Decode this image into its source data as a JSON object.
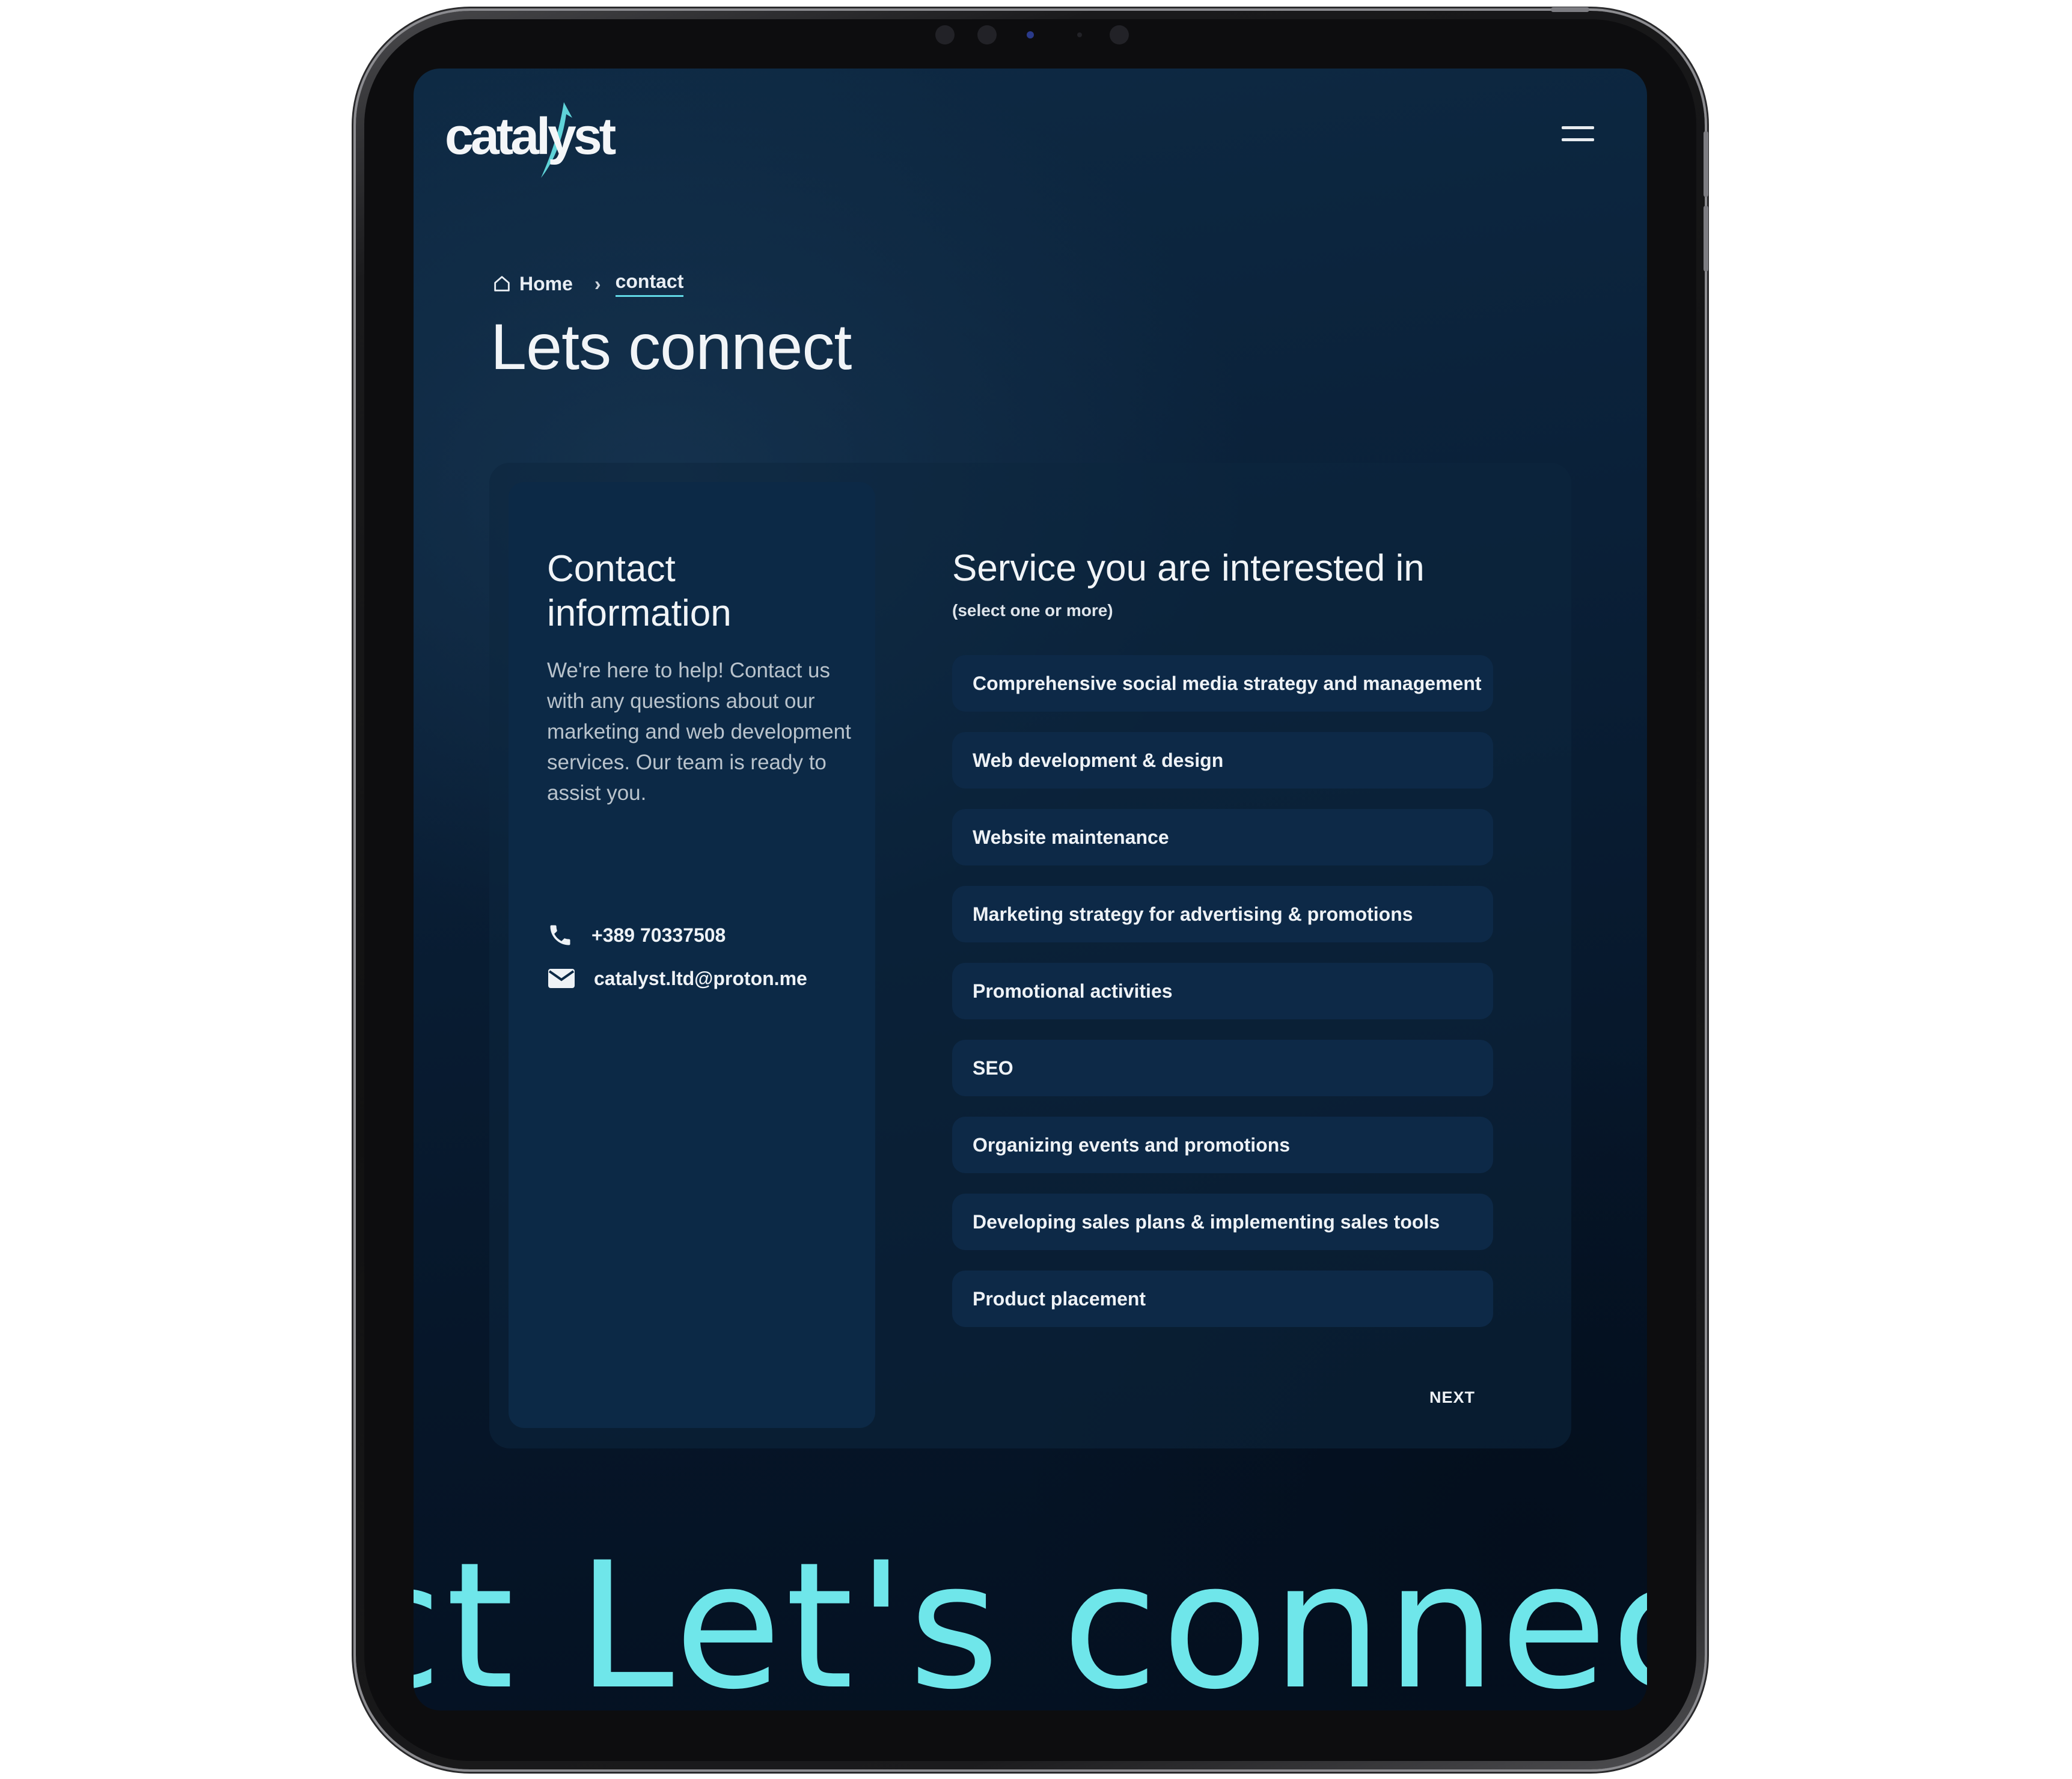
{
  "header": {
    "logo_text": "catalyst",
    "menu_icon": "hamburger-menu-icon"
  },
  "breadcrumb": {
    "home_icon": "home-icon",
    "home_label": "Home",
    "separator_icon": "chevron-right-icon",
    "current_label": "contact"
  },
  "page": {
    "title": "Lets connect"
  },
  "contact_info": {
    "title": "Contact information",
    "description": "We're here to help! Contact us with any questions about our marketing and web development services. Our team is ready to assist you.",
    "phone_icon": "phone-icon",
    "phone": "+389 70337508",
    "email_icon": "mail-icon",
    "email": "catalyst.ltd@proton.me"
  },
  "services": {
    "title": "Service you are interested in",
    "hint": "(select one or more)",
    "items": [
      {
        "label": "Comprehensive social media strategy and management"
      },
      {
        "label": "Web development & design"
      },
      {
        "label": "Website maintenance"
      },
      {
        "label": "Marketing strategy for advertising & promotions"
      },
      {
        "label": "Promotional activities"
      },
      {
        "label": "SEO"
      },
      {
        "label": "Organizing events and promotions"
      },
      {
        "label": "Developing sales plans & implementing sales tools"
      },
      {
        "label": "Product placement"
      }
    ],
    "next_label": "NEXT"
  },
  "marquee": {
    "text": "ct Let's connect"
  },
  "colors": {
    "accent": "#6fe6ea",
    "background": "#0a2038",
    "panel": "#0c2946"
  }
}
